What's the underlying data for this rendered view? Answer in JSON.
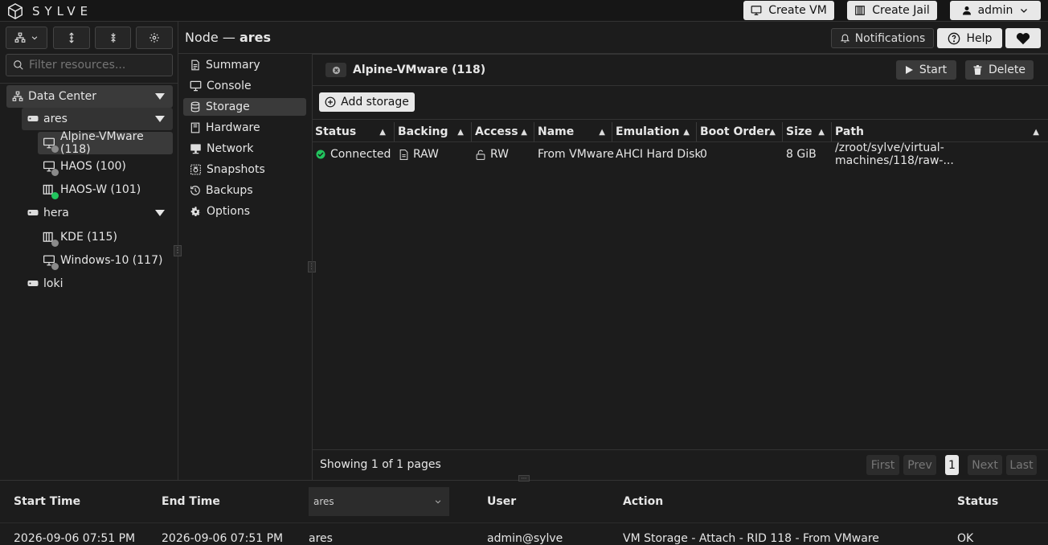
{
  "app": {
    "brand": "SYLVE"
  },
  "header": {
    "create_vm": "Create VM",
    "create_jail": "Create Jail",
    "user": "admin"
  },
  "sidebar": {
    "filter_placeholder": "Filter resources...",
    "tree": {
      "datacenter": "Data Center",
      "nodes": [
        {
          "name": "ares",
          "children": [
            "Alpine-VMware (118)",
            "HAOS (100)",
            "HAOS-W (101)"
          ]
        },
        {
          "name": "hera",
          "children": [
            "KDE (115)",
            "Windows-10 (117)"
          ]
        },
        {
          "name": "loki",
          "children": []
        }
      ]
    }
  },
  "topbar": {
    "node_prefix": "Node —",
    "node_name": "ares",
    "notifications": "Notifications",
    "help": "Help"
  },
  "menu": [
    "Summary",
    "Console",
    "Storage",
    "Hardware",
    "Network",
    "Snapshots",
    "Backups",
    "Options"
  ],
  "panel": {
    "title": "Alpine-VMware (118)",
    "start": "Start",
    "delete": "Delete",
    "add_storage": "Add storage"
  },
  "table": {
    "headers": [
      "Status",
      "Backing",
      "Access",
      "Name",
      "Emulation",
      "Boot Order",
      "Size",
      "Path"
    ],
    "rows": [
      {
        "status": "Connected",
        "backing": "RAW",
        "access": "RW",
        "name": "From VMware",
        "emulation": "AHCI Hard Disk",
        "boot_order": "0",
        "size": "8 GiB",
        "path": "/zroot/sylve/virtual-machines/118/raw-..."
      }
    ]
  },
  "pagination": {
    "showing": "Showing 1 of 1 pages",
    "first": "First",
    "prev": "Prev",
    "page": "1",
    "next": "Next",
    "last": "Last"
  },
  "log": {
    "headers": {
      "start": "Start Time",
      "end": "End Time",
      "node_filter": "ares",
      "user": "User",
      "action": "Action",
      "status": "Status"
    },
    "rows": [
      {
        "start": "2026-09-06 07:51 PM",
        "end": "2026-09-06 07:51 PM",
        "node": "ares",
        "user": "admin@sylve",
        "action": "VM Storage - Attach - RID 118 - From VMware",
        "status": "OK"
      }
    ]
  },
  "colors": {
    "accent_green": "#22c55e",
    "status_gray": "#8a8a8a",
    "selected_bg": "#3a3a3a"
  }
}
